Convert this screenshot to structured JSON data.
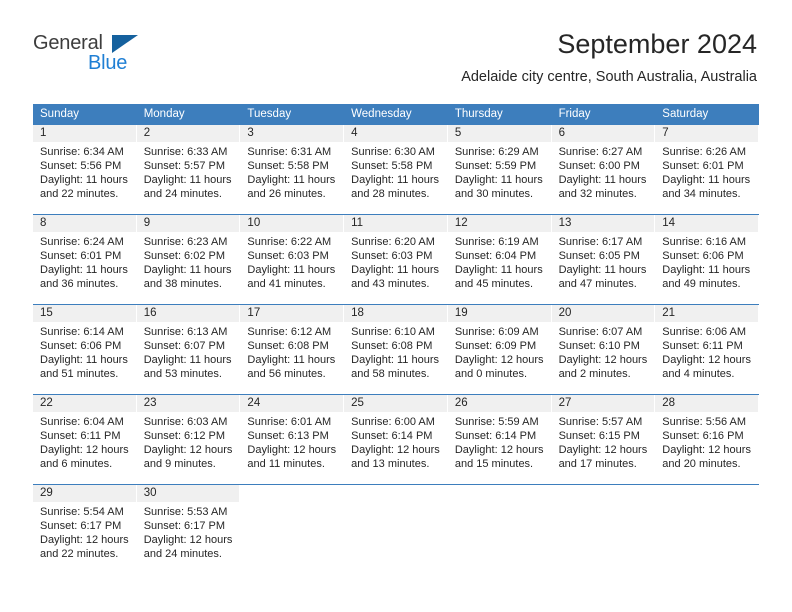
{
  "brand": {
    "name_top": "General",
    "name_bottom": "Blue",
    "triangle_icon": "triangle-icon",
    "accent_color": "#1f7fd4",
    "triangle_color": "#15619e"
  },
  "header": {
    "title": "September 2024",
    "subtitle": "Adelaide city centre, South Australia, Australia"
  },
  "theme": {
    "header_bg": "#3d7ebd",
    "header_text": "#ffffff",
    "daynum_band_bg": "#f0f0f0",
    "body_text": "#262626"
  },
  "weekdays": [
    "Sunday",
    "Monday",
    "Tuesday",
    "Wednesday",
    "Thursday",
    "Friday",
    "Saturday"
  ],
  "weeks": [
    [
      {
        "day": "1",
        "lines": [
          "Sunrise: 6:34 AM",
          "Sunset: 5:56 PM",
          "Daylight: 11 hours",
          "and 22 minutes."
        ]
      },
      {
        "day": "2",
        "lines": [
          "Sunrise: 6:33 AM",
          "Sunset: 5:57 PM",
          "Daylight: 11 hours",
          "and 24 minutes."
        ]
      },
      {
        "day": "3",
        "lines": [
          "Sunrise: 6:31 AM",
          "Sunset: 5:58 PM",
          "Daylight: 11 hours",
          "and 26 minutes."
        ]
      },
      {
        "day": "4",
        "lines": [
          "Sunrise: 6:30 AM",
          "Sunset: 5:58 PM",
          "Daylight: 11 hours",
          "and 28 minutes."
        ]
      },
      {
        "day": "5",
        "lines": [
          "Sunrise: 6:29 AM",
          "Sunset: 5:59 PM",
          "Daylight: 11 hours",
          "and 30 minutes."
        ]
      },
      {
        "day": "6",
        "lines": [
          "Sunrise: 6:27 AM",
          "Sunset: 6:00 PM",
          "Daylight: 11 hours",
          "and 32 minutes."
        ]
      },
      {
        "day": "7",
        "lines": [
          "Sunrise: 6:26 AM",
          "Sunset: 6:01 PM",
          "Daylight: 11 hours",
          "and 34 minutes."
        ]
      }
    ],
    [
      {
        "day": "8",
        "lines": [
          "Sunrise: 6:24 AM",
          "Sunset: 6:01 PM",
          "Daylight: 11 hours",
          "and 36 minutes."
        ]
      },
      {
        "day": "9",
        "lines": [
          "Sunrise: 6:23 AM",
          "Sunset: 6:02 PM",
          "Daylight: 11 hours",
          "and 38 minutes."
        ]
      },
      {
        "day": "10",
        "lines": [
          "Sunrise: 6:22 AM",
          "Sunset: 6:03 PM",
          "Daylight: 11 hours",
          "and 41 minutes."
        ]
      },
      {
        "day": "11",
        "lines": [
          "Sunrise: 6:20 AM",
          "Sunset: 6:03 PM",
          "Daylight: 11 hours",
          "and 43 minutes."
        ]
      },
      {
        "day": "12",
        "lines": [
          "Sunrise: 6:19 AM",
          "Sunset: 6:04 PM",
          "Daylight: 11 hours",
          "and 45 minutes."
        ]
      },
      {
        "day": "13",
        "lines": [
          "Sunrise: 6:17 AM",
          "Sunset: 6:05 PM",
          "Daylight: 11 hours",
          "and 47 minutes."
        ]
      },
      {
        "day": "14",
        "lines": [
          "Sunrise: 6:16 AM",
          "Sunset: 6:06 PM",
          "Daylight: 11 hours",
          "and 49 minutes."
        ]
      }
    ],
    [
      {
        "day": "15",
        "lines": [
          "Sunrise: 6:14 AM",
          "Sunset: 6:06 PM",
          "Daylight: 11 hours",
          "and 51 minutes."
        ]
      },
      {
        "day": "16",
        "lines": [
          "Sunrise: 6:13 AM",
          "Sunset: 6:07 PM",
          "Daylight: 11 hours",
          "and 53 minutes."
        ]
      },
      {
        "day": "17",
        "lines": [
          "Sunrise: 6:12 AM",
          "Sunset: 6:08 PM",
          "Daylight: 11 hours",
          "and 56 minutes."
        ]
      },
      {
        "day": "18",
        "lines": [
          "Sunrise: 6:10 AM",
          "Sunset: 6:08 PM",
          "Daylight: 11 hours",
          "and 58 minutes."
        ]
      },
      {
        "day": "19",
        "lines": [
          "Sunrise: 6:09 AM",
          "Sunset: 6:09 PM",
          "Daylight: 12 hours",
          "and 0 minutes."
        ]
      },
      {
        "day": "20",
        "lines": [
          "Sunrise: 6:07 AM",
          "Sunset: 6:10 PM",
          "Daylight: 12 hours",
          "and 2 minutes."
        ]
      },
      {
        "day": "21",
        "lines": [
          "Sunrise: 6:06 AM",
          "Sunset: 6:11 PM",
          "Daylight: 12 hours",
          "and 4 minutes."
        ]
      }
    ],
    [
      {
        "day": "22",
        "lines": [
          "Sunrise: 6:04 AM",
          "Sunset: 6:11 PM",
          "Daylight: 12 hours",
          "and 6 minutes."
        ]
      },
      {
        "day": "23",
        "lines": [
          "Sunrise: 6:03 AM",
          "Sunset: 6:12 PM",
          "Daylight: 12 hours",
          "and 9 minutes."
        ]
      },
      {
        "day": "24",
        "lines": [
          "Sunrise: 6:01 AM",
          "Sunset: 6:13 PM",
          "Daylight: 12 hours",
          "and 11 minutes."
        ]
      },
      {
        "day": "25",
        "lines": [
          "Sunrise: 6:00 AM",
          "Sunset: 6:14 PM",
          "Daylight: 12 hours",
          "and 13 minutes."
        ]
      },
      {
        "day": "26",
        "lines": [
          "Sunrise: 5:59 AM",
          "Sunset: 6:14 PM",
          "Daylight: 12 hours",
          "and 15 minutes."
        ]
      },
      {
        "day": "27",
        "lines": [
          "Sunrise: 5:57 AM",
          "Sunset: 6:15 PM",
          "Daylight: 12 hours",
          "and 17 minutes."
        ]
      },
      {
        "day": "28",
        "lines": [
          "Sunrise: 5:56 AM",
          "Sunset: 6:16 PM",
          "Daylight: 12 hours",
          "and 20 minutes."
        ]
      }
    ],
    [
      {
        "day": "29",
        "lines": [
          "Sunrise: 5:54 AM",
          "Sunset: 6:17 PM",
          "Daylight: 12 hours",
          "and 22 minutes."
        ]
      },
      {
        "day": "30",
        "lines": [
          "Sunrise: 5:53 AM",
          "Sunset: 6:17 PM",
          "Daylight: 12 hours",
          "and 24 minutes."
        ]
      },
      {
        "day": "",
        "lines": []
      },
      {
        "day": "",
        "lines": []
      },
      {
        "day": "",
        "lines": []
      },
      {
        "day": "",
        "lines": []
      },
      {
        "day": "",
        "lines": []
      }
    ]
  ]
}
